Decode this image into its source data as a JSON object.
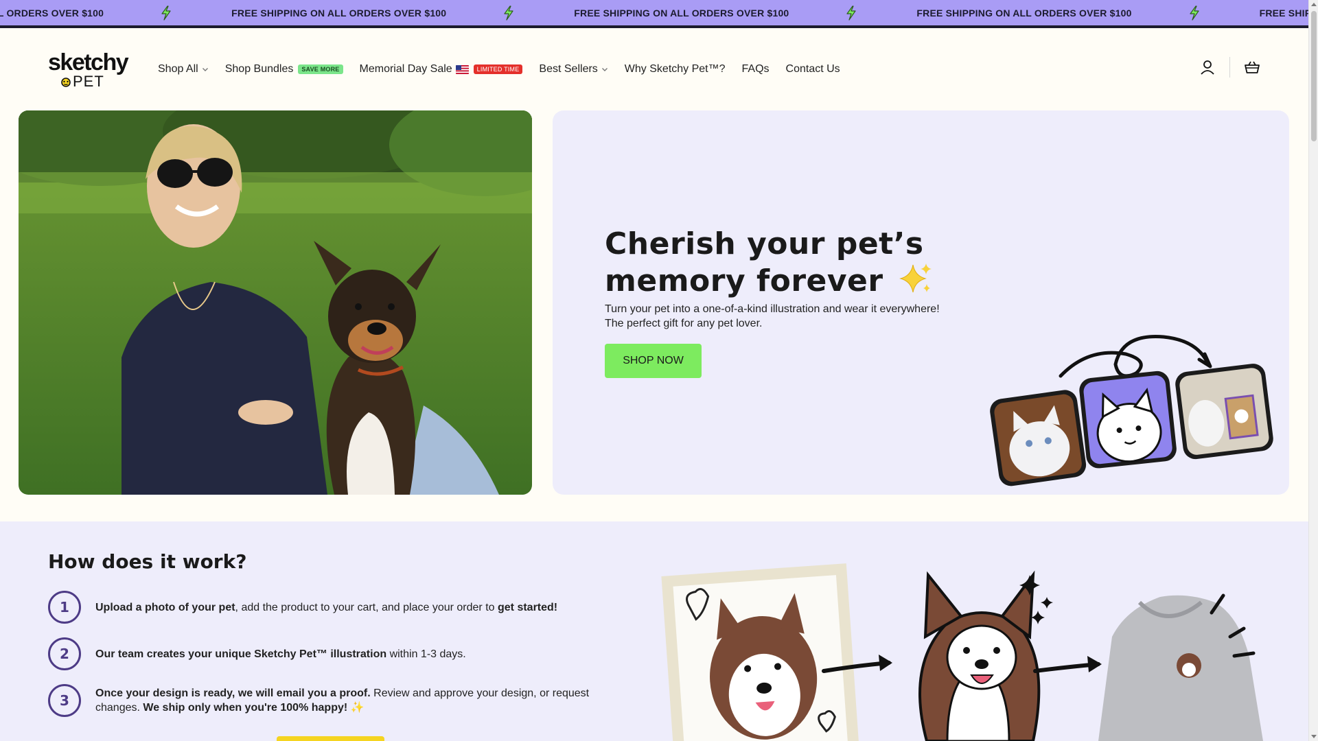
{
  "announcement": {
    "message": "FREE SHIPPING ON ALL ORDERS OVER $100",
    "bolt_icon": "bolt-icon",
    "background": "#a99cf5"
  },
  "header": {
    "logo": {
      "line1": "sketchy",
      "line2": "PET"
    },
    "nav": [
      {
        "label": "Shop All",
        "dropdown": true
      },
      {
        "label": "Shop Bundles",
        "badge": "SAVE MORE"
      },
      {
        "label": "Memorial Day Sale",
        "badge": "LIMITED TIME",
        "flag": "us-flag-icon"
      },
      {
        "label": "Best Sellers",
        "dropdown": true
      },
      {
        "label": "Why Sketchy Pet™?"
      },
      {
        "label": "FAQs"
      },
      {
        "label": "Contact Us"
      }
    ],
    "icons": [
      "account-icon",
      "cart-icon"
    ]
  },
  "hero": {
    "title_line1": "Cherish your pet’s",
    "title_line2": "memory forever",
    "subtitle_line1": "Turn your pet into a one-of-a-kind illustration and wear it everywhere!",
    "subtitle_line2": "The perfect gift for any pet lover.",
    "cta": "SHOP NOW",
    "cta_color": "#7deb5f",
    "card_color": "#eeedfb"
  },
  "how": {
    "title": "How does it work?",
    "steps": [
      {
        "number": "1",
        "parts": [
          {
            "b": "Upload a photo of your pet"
          },
          {
            "t": ", add the product to your cart, and place your order to "
          },
          {
            "b": "get started!"
          }
        ]
      },
      {
        "number": "2",
        "parts": [
          {
            "b": "Our team creates your unique Sketchy Pet™ illustration"
          },
          {
            "t": " within 1-3 days."
          }
        ]
      },
      {
        "number": "3",
        "parts": [
          {
            "b": "Once your design is ready, we will email you a proof."
          },
          {
            "t": " Review and approve your design, or request changes. "
          },
          {
            "b": "We ship only when you're 100% happy!"
          },
          {
            "t": " ✨"
          }
        ]
      }
    ],
    "accent_color": "#4d3b86"
  }
}
